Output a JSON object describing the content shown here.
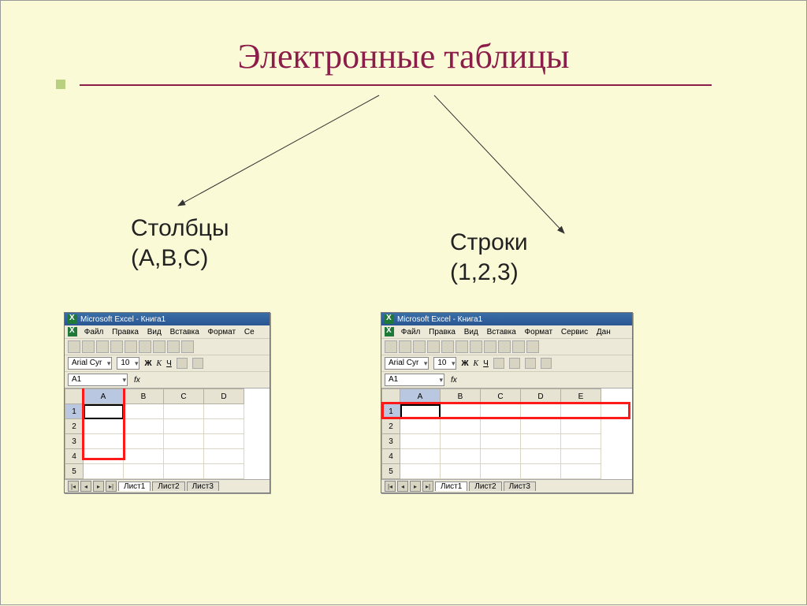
{
  "title": "Электронные таблицы",
  "left_label_line1": "Столбцы",
  "left_label_line2": "(A,B,C)",
  "right_label_line1": "Строки",
  "right_label_line2": "(1,2,3)",
  "excel": {
    "window_title": "Microsoft Excel - Книга1",
    "menus_short": [
      "Файл",
      "Правка",
      "Вид",
      "Вставка",
      "Формат",
      "Се"
    ],
    "menus_long": [
      "Файл",
      "Правка",
      "Вид",
      "Вставка",
      "Формат",
      "Сервис",
      "Дан"
    ],
    "font": "Arial Cyr",
    "font_size": "10",
    "bold": "Ж",
    "italic": "К",
    "underline": "Ч",
    "namebox": "A1",
    "fx": "fx",
    "cols_short": [
      "A",
      "B",
      "C",
      "D"
    ],
    "cols_long": [
      "A",
      "B",
      "C",
      "D",
      "E"
    ],
    "rows": [
      "1",
      "2",
      "3",
      "4",
      "5"
    ],
    "tabs": [
      "Лист1",
      "Лист2",
      "Лист3"
    ]
  }
}
